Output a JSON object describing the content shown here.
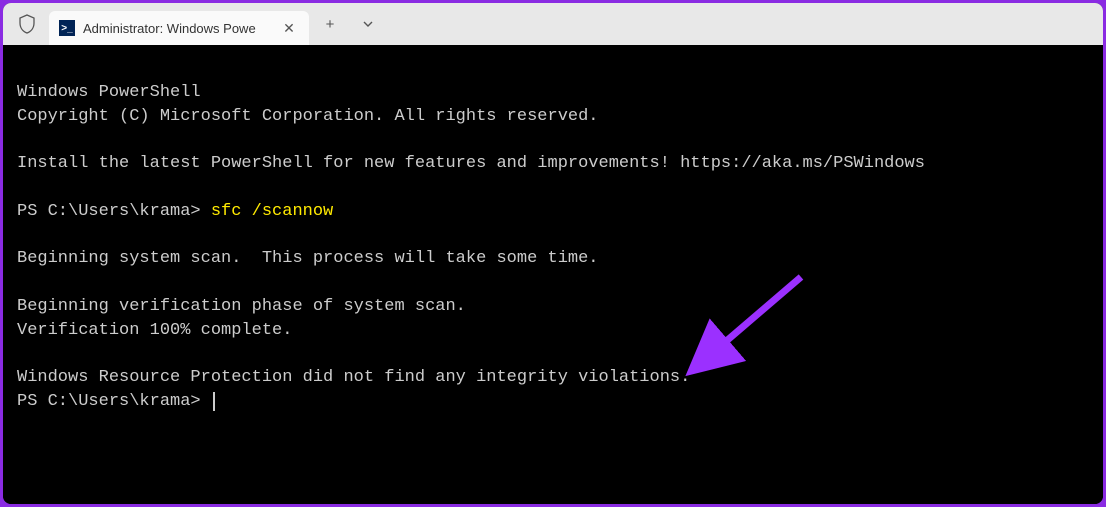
{
  "tab": {
    "title": "Administrator: Windows Powe",
    "icon_label": ">_"
  },
  "terminal": {
    "line1": "Windows PowerShell",
    "line2": "Copyright (C) Microsoft Corporation. All rights reserved.",
    "line3": "Install the latest PowerShell for new features and improvements! https://aka.ms/PSWindows",
    "prompt1": "PS C:\\Users\\krama> ",
    "command": "sfc /scannow",
    "line4": "Beginning system scan.  This process will take some time.",
    "line5": "Beginning verification phase of system scan.",
    "line6": "Verification 100% complete.",
    "line7": "Windows Resource Protection did not find any integrity violations.",
    "prompt2": "PS C:\\Users\\krama>"
  },
  "titlebar_buttons": {
    "new_tab": "+",
    "dropdown": "⌄",
    "close": "✕"
  },
  "annotation": {
    "arrow_color": "#9b30ff"
  }
}
